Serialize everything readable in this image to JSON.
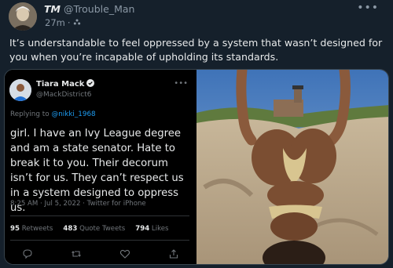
{
  "outer_tweet": {
    "display_name": "TM",
    "handle": "@Trouble_Man",
    "time": "27m",
    "separator": "·",
    "text": "It’s understandable to feel oppressed by a system that wasn’t designed for you when you’re incapable of upholding its standards.",
    "icons": {
      "more": "more-icon",
      "audience": "audience-icon",
      "verified": "verified-badge-icon"
    }
  },
  "quoted_tweet": {
    "display_name": "Tiara Mack",
    "handle": "@MackDistrict6",
    "reply_prefix": "Replying to",
    "reply_to": "@nikki_1968",
    "text": "girl. I have an Ivy League degree and am a state senator. Hate to break it to you. Their decorum isn’t for us. They can’t respect us in a system designed to oppress us.",
    "timestamp": "8:25 AM · Jul 5, 2022 · Twitter for iPhone",
    "stats": {
      "retweets_count": "95",
      "retweets_label": "Retweets",
      "quotes_count": "483",
      "quotes_label": "Quote Tweets",
      "likes_count": "794",
      "likes_label": "Likes"
    },
    "actions": [
      "reply-icon",
      "retweet-icon",
      "like-icon",
      "share-icon"
    ]
  },
  "colors": {
    "background": "#15202b",
    "embed_background": "#000000",
    "accent": "#1d9bf0",
    "text_primary": "#e7e9ea",
    "text_secondary": "#8b98a5",
    "border": "#38444d"
  }
}
